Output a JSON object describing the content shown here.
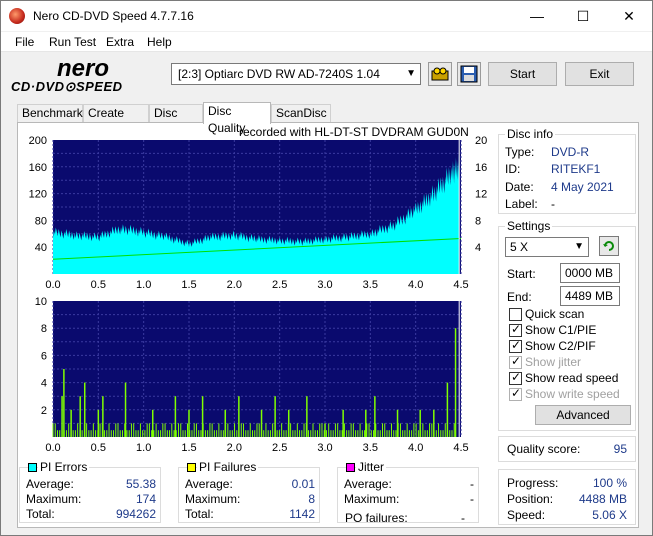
{
  "window": {
    "title": "Nero CD-DVD Speed 4.7.7.16",
    "minimize": "—",
    "maximize": "☐",
    "close": "✕"
  },
  "menu": [
    "File",
    "Run Test",
    "Extra",
    "Help"
  ],
  "toolbar": {
    "drive": "[2:3]   Optiarc DVD RW AD-7240S 1.04",
    "start": "Start",
    "exit": "Exit"
  },
  "tabs": [
    "Benchmark",
    "Create Disc",
    "Disc Info",
    "Disc Quality",
    "ScanDisc"
  ],
  "active_tab": "Disc Quality",
  "recorded_with": "recorded with HL-DT-ST DVDRAM GUD0N",
  "disc_info": {
    "title": "Disc info",
    "type_label": "Type:",
    "type": "DVD-R",
    "id_label": "ID:",
    "id": "RITEKF1",
    "date_label": "Date:",
    "date": "4 May 2021",
    "label_label": "Label:",
    "label": "-"
  },
  "settings": {
    "title": "Settings",
    "speed": "5 X",
    "start_label": "Start:",
    "start": "0000 MB",
    "end_label": "End:",
    "end": "4489 MB",
    "quick_scan": "Quick scan",
    "show_c1pie": "Show C1/PIE",
    "show_c2pif": "Show C2/PIF",
    "show_jitter": "Show jitter",
    "show_read_speed": "Show read speed",
    "show_write_speed": "Show write speed",
    "advanced": "Advanced"
  },
  "quality": {
    "label": "Quality score:",
    "value": "95"
  },
  "progress": {
    "progress_label": "Progress:",
    "progress": "100 %",
    "position_label": "Position:",
    "position": "4488 MB",
    "speed_label": "Speed:",
    "speed": "5.06 X"
  },
  "pi_errors": {
    "title": "PI Errors",
    "avg_label": "Average:",
    "avg": "55.38",
    "max_label": "Maximum:",
    "max": "174",
    "total_label": "Total:",
    "total": "994262",
    "color": "#00ffff"
  },
  "pi_failures": {
    "title": "PI Failures",
    "avg_label": "Average:",
    "avg": "0.01",
    "max_label": "Maximum:",
    "max": "8",
    "total_label": "Total:",
    "total": "1142",
    "color": "#ffff00"
  },
  "jitter": {
    "title": "Jitter",
    "avg_label": "Average:",
    "avg": "-",
    "max_label": "Maximum:",
    "max": "-",
    "po_label": "PO failures:",
    "po": "-",
    "color": "#ff00ff"
  },
  "chart_data": [
    {
      "type": "area",
      "name": "PI Errors",
      "x_ticks": [
        "0.0",
        "0.5",
        "1.0",
        "1.5",
        "2.0",
        "2.5",
        "3.0",
        "3.5",
        "4.0",
        "4.5"
      ],
      "y_ticks_left": [
        "200",
        "160",
        "120",
        "80",
        "40"
      ],
      "y_ticks_right": [
        "20",
        "16",
        "12",
        "8",
        "4"
      ],
      "xlim": [
        0,
        4.5
      ],
      "ylim_left": [
        0,
        200
      ],
      "ylim_right": [
        0,
        20
      ],
      "x": [
        0.0,
        0.25,
        0.5,
        0.75,
        1.0,
        1.25,
        1.5,
        1.75,
        2.0,
        2.25,
        2.5,
        2.75,
        3.0,
        3.25,
        3.5,
        3.75,
        4.0,
        4.2,
        4.4,
        4.48
      ],
      "pi_values": [
        62,
        58,
        55,
        68,
        62,
        55,
        45,
        55,
        58,
        52,
        50,
        48,
        52,
        55,
        60,
        72,
        95,
        120,
        150,
        160
      ],
      "read_speed_x": [
        0.0,
        4.5
      ],
      "read_speed_y": [
        2.2,
        5.3
      ],
      "colors": {
        "pi": "#00ffff",
        "read_speed": "#00e000",
        "background": "#0a0a6e",
        "grid": "#3a3aa0"
      }
    },
    {
      "type": "bar",
      "name": "PI Failures",
      "x_ticks": [
        "0.0",
        "0.5",
        "1.0",
        "1.5",
        "2.0",
        "2.5",
        "3.0",
        "3.5",
        "4.0",
        "4.5"
      ],
      "y_ticks": [
        "10",
        "8",
        "6",
        "4",
        "2"
      ],
      "xlim": [
        0,
        4.5
      ],
      "ylim": [
        0,
        10
      ],
      "x": [
        0.1,
        0.12,
        0.2,
        0.3,
        0.35,
        0.5,
        0.55,
        0.8,
        1.1,
        1.35,
        1.5,
        1.65,
        1.9,
        2.05,
        2.3,
        2.45,
        2.6,
        2.8,
        3.0,
        3.2,
        3.45,
        3.55,
        3.8,
        4.05,
        4.2,
        4.35,
        4.44
      ],
      "values": [
        3,
        5,
        2,
        3,
        4,
        2,
        3,
        4,
        2,
        3,
        2,
        3,
        2,
        3,
        2,
        3,
        2,
        3,
        1,
        2,
        2,
        3,
        2,
        2,
        2,
        4,
        8
      ],
      "colors": {
        "bars": "#80ff00",
        "background": "#0a0a6e",
        "grid": "#3a3aa0"
      }
    }
  ]
}
